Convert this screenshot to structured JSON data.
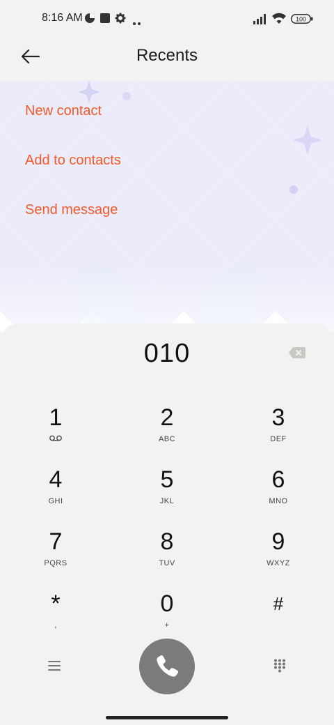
{
  "status_bar": {
    "time": "8:16 AM",
    "battery": "100"
  },
  "header": {
    "title": "Recents"
  },
  "actions": [
    "New contact",
    "Add to contacts",
    "Send message"
  ],
  "dialer": {
    "number": "010",
    "keys": [
      {
        "digit": "1",
        "letters": "",
        "voicemail": true
      },
      {
        "digit": "2",
        "letters": "ABC"
      },
      {
        "digit": "3",
        "letters": "DEF"
      },
      {
        "digit": "4",
        "letters": "GHI"
      },
      {
        "digit": "5",
        "letters": "JKL"
      },
      {
        "digit": "6",
        "letters": "MNO"
      },
      {
        "digit": "7",
        "letters": "PQRS"
      },
      {
        "digit": "8",
        "letters": "TUV"
      },
      {
        "digit": "9",
        "letters": "WXYZ"
      },
      {
        "digit": "*",
        "letters": ","
      },
      {
        "digit": "0",
        "letters": "+"
      },
      {
        "digit": "#",
        "letters": ""
      }
    ]
  },
  "colors": {
    "accent": "#f05a2a",
    "call_button": "#7b7b7b"
  }
}
